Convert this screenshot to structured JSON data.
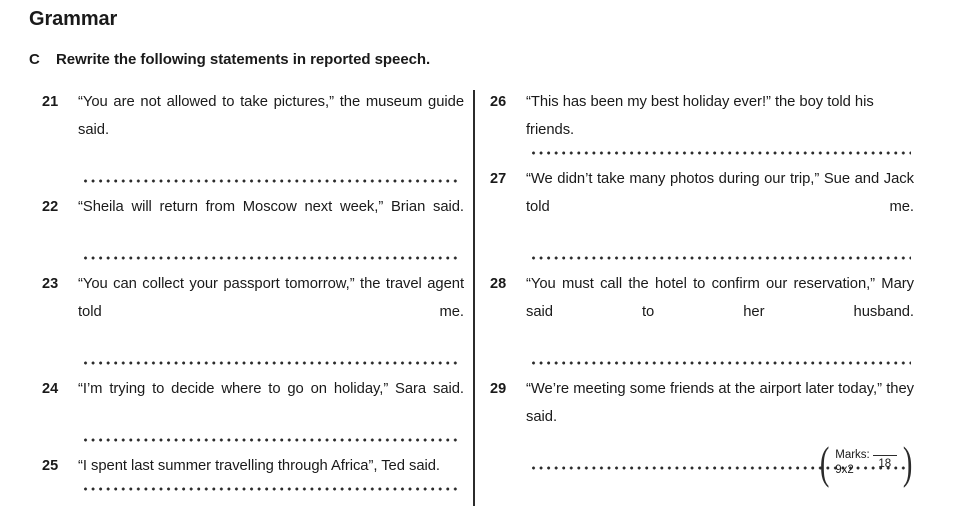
{
  "section": {
    "title": "Grammar"
  },
  "instruction": {
    "letter": "C",
    "text": "Rewrite the following statements in reported speech."
  },
  "columns": {
    "left": [
      {
        "number": "21",
        "text": "“You are not allowed to take pictures,” the museum guide said.",
        "justified": true
      },
      {
        "number": "22",
        "text": "“Sheila will return from Moscow next week,” Brian said.",
        "justified": true
      },
      {
        "number": "23",
        "text": "“You can collect your passport tomorrow,” the travel agent told me.",
        "justified": true
      },
      {
        "number": "24",
        "text": "“I’m trying to decide where to go on holiday,” Sara said.",
        "justified": true
      },
      {
        "number": "25",
        "text": "“I spent last summer travelling through Africa”, Ted said.",
        "justified": false
      }
    ],
    "right": [
      {
        "number": "26",
        "text": "“This has been my best holiday ever!” the boy told his friends.",
        "justified": false
      },
      {
        "number": "27",
        "text": "“We didn’t take many photos during our trip,” Sue and Jack told me.",
        "justified": true
      },
      {
        "number": "28",
        "text": "“You must call the hotel to confirm our reservation,” Mary said to her husband.",
        "justified": true
      },
      {
        "number": "29",
        "text": "“We’re meeting some friends at the airport later today,” they said.",
        "justified": true
      }
    ]
  },
  "marks": {
    "label": "Marks:",
    "weighting": "9x2",
    "total": "18",
    "open_paren": "(",
    "close_paren": ")"
  }
}
